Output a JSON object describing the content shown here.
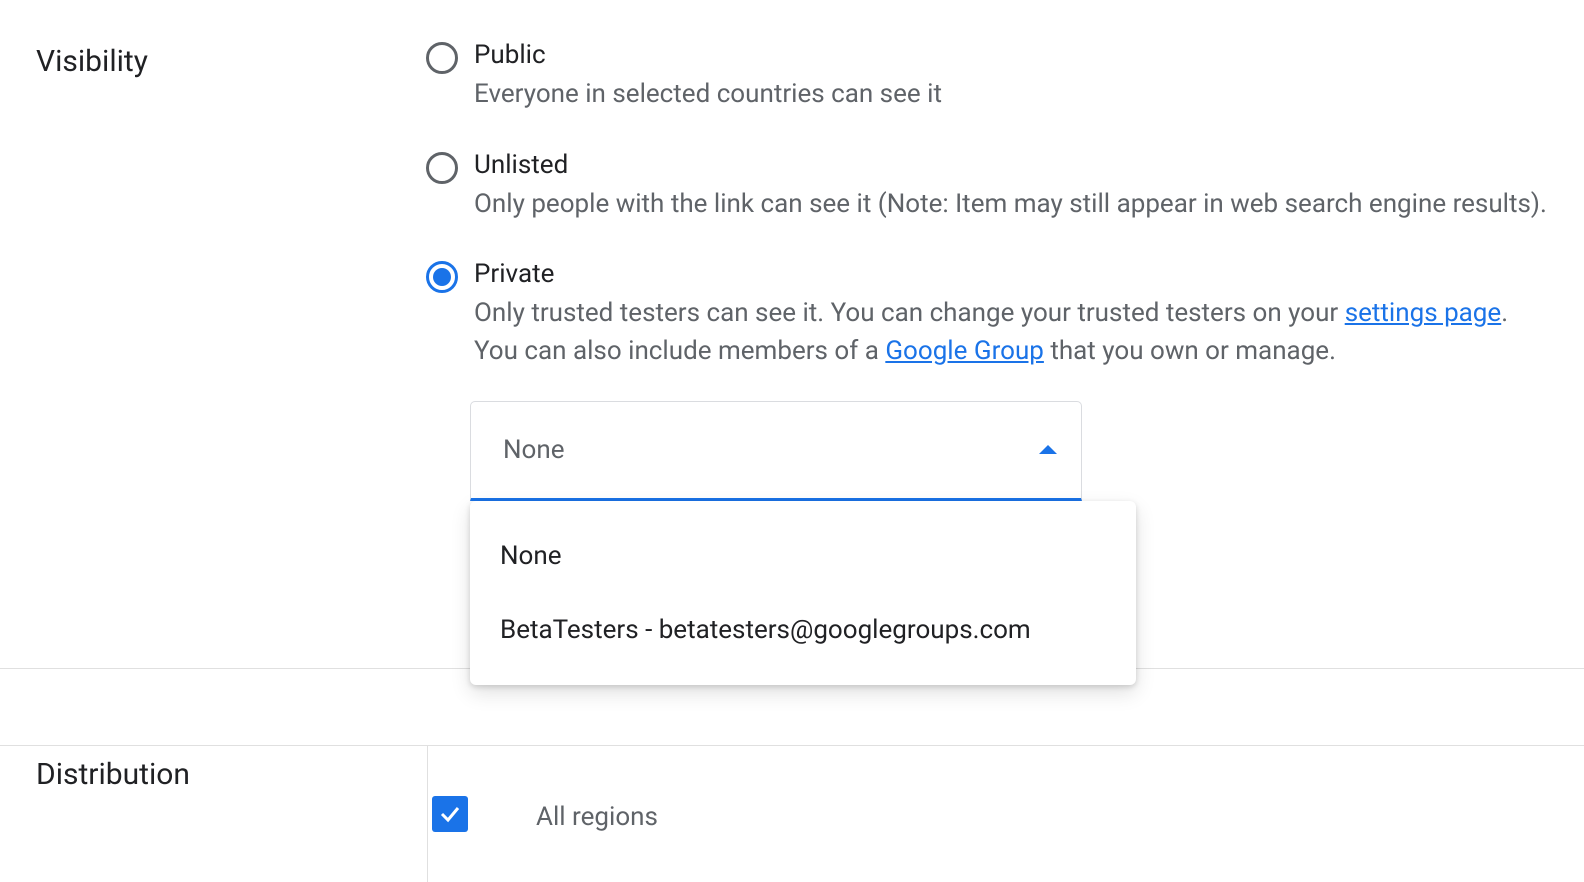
{
  "visibility": {
    "label": "Visibility",
    "options": [
      {
        "title": "Public",
        "desc": "Everyone in selected countries can see it",
        "selected": false
      },
      {
        "title": "Unlisted",
        "desc": "Only people with the link can see it (Note: Item may still appear in web search engine results).",
        "selected": false
      },
      {
        "title": "Private",
        "desc_part1": "Only trusted testers can see it. You can change your trusted testers on your ",
        "link1_text": "settings page",
        "desc_part2": ".",
        "desc_part3": "You can also include members of a ",
        "link2_text": "Google Group",
        "desc_part4": " that you own or manage.",
        "selected": true
      }
    ],
    "dropdown": {
      "selected": "None",
      "options": [
        "None",
        "BetaTesters - betatesters@googlegroups.com"
      ]
    }
  },
  "distribution": {
    "label": "Distribution",
    "checkbox_label": "All regions"
  }
}
